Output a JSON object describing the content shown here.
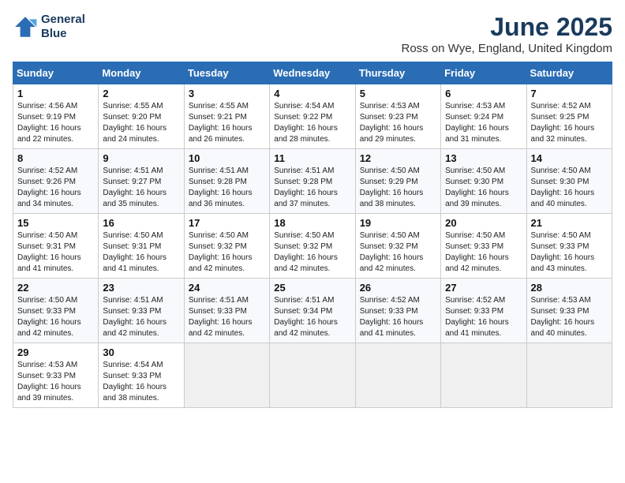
{
  "logo": {
    "line1": "General",
    "line2": "Blue"
  },
  "title": "June 2025",
  "subtitle": "Ross on Wye, England, United Kingdom",
  "days_of_week": [
    "Sunday",
    "Monday",
    "Tuesday",
    "Wednesday",
    "Thursday",
    "Friday",
    "Saturday"
  ],
  "weeks": [
    [
      {
        "day": 1,
        "sunrise": "4:56 AM",
        "sunset": "9:19 PM",
        "daylight": "16 hours and 22 minutes."
      },
      {
        "day": 2,
        "sunrise": "4:55 AM",
        "sunset": "9:20 PM",
        "daylight": "16 hours and 24 minutes."
      },
      {
        "day": 3,
        "sunrise": "4:55 AM",
        "sunset": "9:21 PM",
        "daylight": "16 hours and 26 minutes."
      },
      {
        "day": 4,
        "sunrise": "4:54 AM",
        "sunset": "9:22 PM",
        "daylight": "16 hours and 28 minutes."
      },
      {
        "day": 5,
        "sunrise": "4:53 AM",
        "sunset": "9:23 PM",
        "daylight": "16 hours and 29 minutes."
      },
      {
        "day": 6,
        "sunrise": "4:53 AM",
        "sunset": "9:24 PM",
        "daylight": "16 hours and 31 minutes."
      },
      {
        "day": 7,
        "sunrise": "4:52 AM",
        "sunset": "9:25 PM",
        "daylight": "16 hours and 32 minutes."
      }
    ],
    [
      {
        "day": 8,
        "sunrise": "4:52 AM",
        "sunset": "9:26 PM",
        "daylight": "16 hours and 34 minutes."
      },
      {
        "day": 9,
        "sunrise": "4:51 AM",
        "sunset": "9:27 PM",
        "daylight": "16 hours and 35 minutes."
      },
      {
        "day": 10,
        "sunrise": "4:51 AM",
        "sunset": "9:28 PM",
        "daylight": "16 hours and 36 minutes."
      },
      {
        "day": 11,
        "sunrise": "4:51 AM",
        "sunset": "9:28 PM",
        "daylight": "16 hours and 37 minutes."
      },
      {
        "day": 12,
        "sunrise": "4:50 AM",
        "sunset": "9:29 PM",
        "daylight": "16 hours and 38 minutes."
      },
      {
        "day": 13,
        "sunrise": "4:50 AM",
        "sunset": "9:30 PM",
        "daylight": "16 hours and 39 minutes."
      },
      {
        "day": 14,
        "sunrise": "4:50 AM",
        "sunset": "9:30 PM",
        "daylight": "16 hours and 40 minutes."
      }
    ],
    [
      {
        "day": 15,
        "sunrise": "4:50 AM",
        "sunset": "9:31 PM",
        "daylight": "16 hours and 41 minutes."
      },
      {
        "day": 16,
        "sunrise": "4:50 AM",
        "sunset": "9:31 PM",
        "daylight": "16 hours and 41 minutes."
      },
      {
        "day": 17,
        "sunrise": "4:50 AM",
        "sunset": "9:32 PM",
        "daylight": "16 hours and 42 minutes."
      },
      {
        "day": 18,
        "sunrise": "4:50 AM",
        "sunset": "9:32 PM",
        "daylight": "16 hours and 42 minutes."
      },
      {
        "day": 19,
        "sunrise": "4:50 AM",
        "sunset": "9:32 PM",
        "daylight": "16 hours and 42 minutes."
      },
      {
        "day": 20,
        "sunrise": "4:50 AM",
        "sunset": "9:33 PM",
        "daylight": "16 hours and 42 minutes."
      },
      {
        "day": 21,
        "sunrise": "4:50 AM",
        "sunset": "9:33 PM",
        "daylight": "16 hours and 43 minutes."
      }
    ],
    [
      {
        "day": 22,
        "sunrise": "4:50 AM",
        "sunset": "9:33 PM",
        "daylight": "16 hours and 42 minutes."
      },
      {
        "day": 23,
        "sunrise": "4:51 AM",
        "sunset": "9:33 PM",
        "daylight": "16 hours and 42 minutes."
      },
      {
        "day": 24,
        "sunrise": "4:51 AM",
        "sunset": "9:33 PM",
        "daylight": "16 hours and 42 minutes."
      },
      {
        "day": 25,
        "sunrise": "4:51 AM",
        "sunset": "9:34 PM",
        "daylight": "16 hours and 42 minutes."
      },
      {
        "day": 26,
        "sunrise": "4:52 AM",
        "sunset": "9:33 PM",
        "daylight": "16 hours and 41 minutes."
      },
      {
        "day": 27,
        "sunrise": "4:52 AM",
        "sunset": "9:33 PM",
        "daylight": "16 hours and 41 minutes."
      },
      {
        "day": 28,
        "sunrise": "4:53 AM",
        "sunset": "9:33 PM",
        "daylight": "16 hours and 40 minutes."
      }
    ],
    [
      {
        "day": 29,
        "sunrise": "4:53 AM",
        "sunset": "9:33 PM",
        "daylight": "16 hours and 39 minutes."
      },
      {
        "day": 30,
        "sunrise": "4:54 AM",
        "sunset": "9:33 PM",
        "daylight": "16 hours and 38 minutes."
      },
      null,
      null,
      null,
      null,
      null
    ]
  ]
}
